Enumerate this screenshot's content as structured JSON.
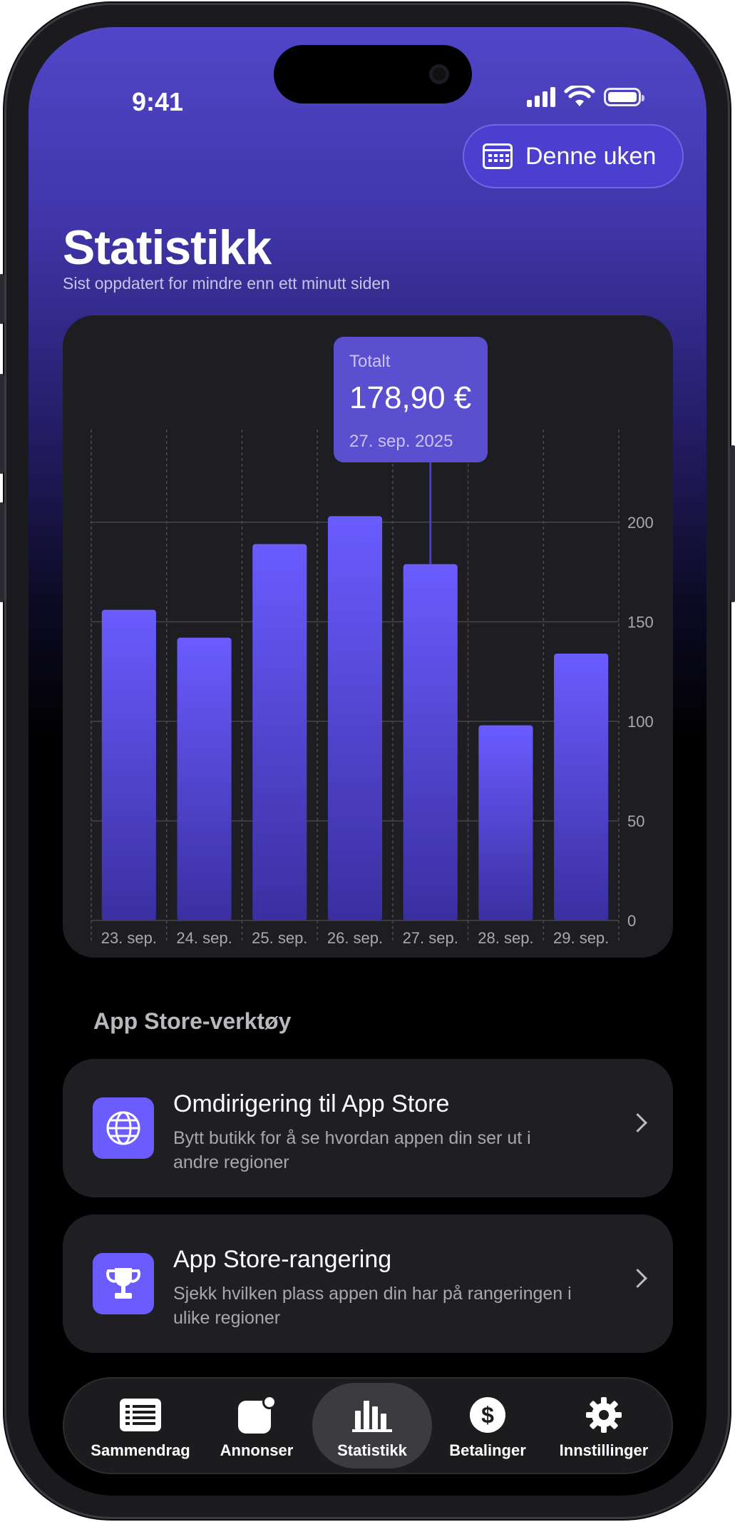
{
  "status": {
    "time": "9:41"
  },
  "header": {
    "range_button": "Denne uken",
    "title": "Statistikk",
    "subtitle": "Sist oppdatert for mindre enn ett minutt siden"
  },
  "tooltip": {
    "label": "Totalt",
    "value": "178,90 €",
    "date": "27. sep. 2025"
  },
  "chart_data": {
    "type": "bar",
    "categories": [
      "23. sep.",
      "24. sep.",
      "25. sep.",
      "26. sep.",
      "27. sep.",
      "28. sep.",
      "29. sep."
    ],
    "values": [
      156,
      142,
      189,
      203,
      178.9,
      98,
      134
    ],
    "yticks": [
      0,
      50,
      100,
      150,
      200
    ],
    "ylim": [
      0,
      225
    ],
    "selected_index": 4,
    "bar_color": "#6a5cff",
    "grid": true,
    "y_axis_side": "right"
  },
  "section": {
    "title": "App Store-verktøy"
  },
  "tools": [
    {
      "icon": "globe-icon",
      "title": "Omdirigering til App Store",
      "desc": "Bytt butikk for å se hvordan appen din ser ut i andre regioner"
    },
    {
      "icon": "trophy-icon",
      "title": "App Store-rangering",
      "desc": "Sjekk hvilken plass appen din har på rangeringen i ulike regioner"
    }
  ],
  "tabs": [
    {
      "icon": "list-icon",
      "label": "Sammendrag"
    },
    {
      "icon": "ads-icon",
      "label": "Annonser"
    },
    {
      "icon": "bar-chart-icon",
      "label": "Statistikk",
      "active": true
    },
    {
      "icon": "dollar-icon",
      "label": "Betalinger"
    },
    {
      "icon": "gear-icon",
      "label": "Innstillinger"
    }
  ],
  "colors": {
    "accent": "#6a5cff",
    "card": "#1e1e22",
    "tooltip": "#5a4fcf"
  }
}
